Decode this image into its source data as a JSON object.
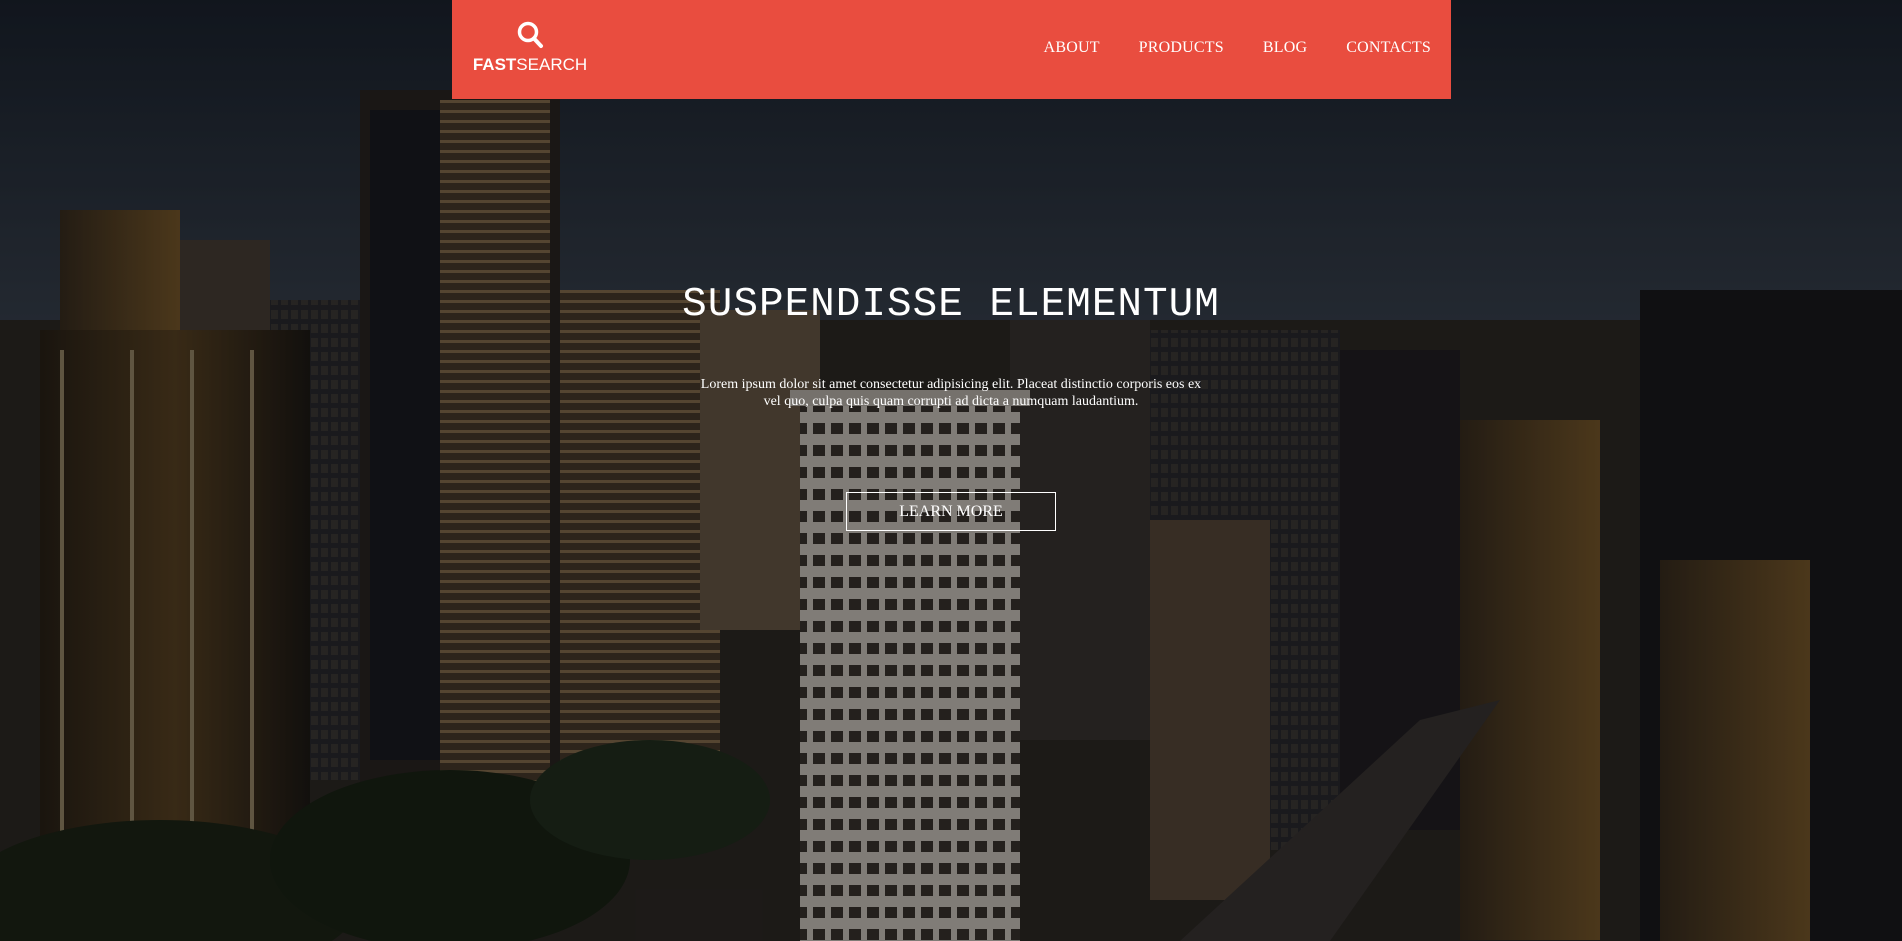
{
  "header": {
    "logo": {
      "icon": "search-icon",
      "bold": "FAST",
      "regular": "SEARCH"
    },
    "nav": [
      "ABOUT",
      "PRODUCTS",
      "BLOG",
      "CONTACTS"
    ]
  },
  "hero": {
    "title": "SUSPENDISSE ELEMENTUM",
    "text": "Lorem ipsum dolor sit amet consectetur adipisicing elit. Placeat distinctio corporis eos ex vel quo, culpa quis quam corrupti ad dicta a numquam laudantium.",
    "button_label": "LEARN MORE",
    "background": "city-skyline-photo"
  },
  "colors": {
    "brand": "#e94d3f",
    "text": "#ffffff"
  }
}
